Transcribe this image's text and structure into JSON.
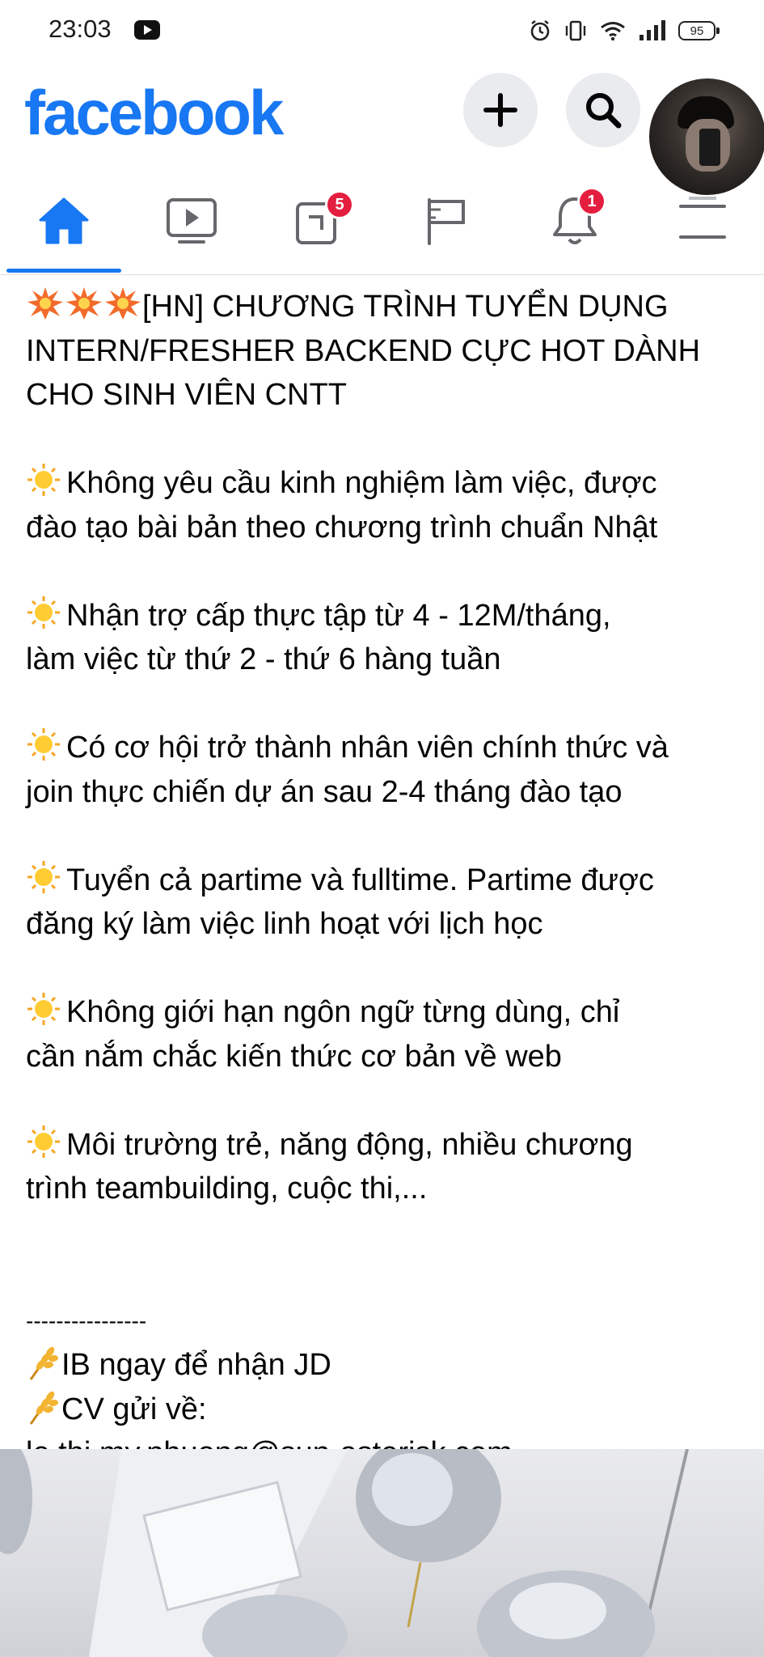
{
  "status_bar": {
    "time": "23:03",
    "icons": [
      "youtube-icon",
      "alarm-icon",
      "vibrate-icon",
      "wifi-icon",
      "signal-icon",
      "battery-icon"
    ],
    "battery": "95"
  },
  "header": {
    "logo": "facebook",
    "brand_color": "#1877f2",
    "actions": [
      "add-icon",
      "search-icon"
    ],
    "avatar": "profile-avatar"
  },
  "tabs": {
    "items": [
      {
        "name": "home",
        "icon": "home-icon",
        "active": true
      },
      {
        "name": "watch",
        "icon": "video-icon",
        "active": false
      },
      {
        "name": "pages",
        "icon": "pages-icon",
        "badge": "5"
      },
      {
        "name": "flag",
        "icon": "flag-icon",
        "active": false
      },
      {
        "name": "notifications",
        "icon": "bell-icon",
        "badge": "1"
      },
      {
        "name": "menu",
        "icon": "menu-icon",
        "active": false
      }
    ]
  },
  "post": {
    "title_line1": "[HN] CHƯƠNG TRÌNH TUYỂN DỤNG",
    "title_line2": "INTERN/FRESHER BACKEND CỰC HOT DÀNH",
    "title_line3": "CHO SINH VIÊN CNTT",
    "bullets": [
      {
        "l1": "Không yêu cầu kinh nghiệm làm việc, được",
        "l2": "đào tạo bài bản theo chương trình chuẩn Nhật"
      },
      {
        "l1": "Nhận trợ cấp thực tập từ 4 - 12M/tháng,",
        "l2": "làm việc từ thứ 2 - thứ 6 hàng tuần"
      },
      {
        "l1": "Có cơ hội trở thành nhân viên chính thức và",
        "l2": "join thực chiến dự án sau 2-4 tháng đào tạo"
      },
      {
        "l1": "Tuyển cả partime và fulltime. Partime được",
        "l2": "đăng ký làm việc linh hoạt với lịch học"
      },
      {
        "l1": "Không giới hạn ngôn ngữ từng dùng, chỉ",
        "l2": "cần nắm chắc kiến thức cơ bản về web"
      },
      {
        "l1": "Môi trường trẻ, năng động, nhiều chương",
        "l2": "trình teambuilding, cuộc thi,..."
      }
    ],
    "divider": "----------------",
    "ib": "IB ngay để nhận JD",
    "cv": "CV gửi về:",
    "email": "le.thi.my.phuong@sun-asterisk.com"
  }
}
